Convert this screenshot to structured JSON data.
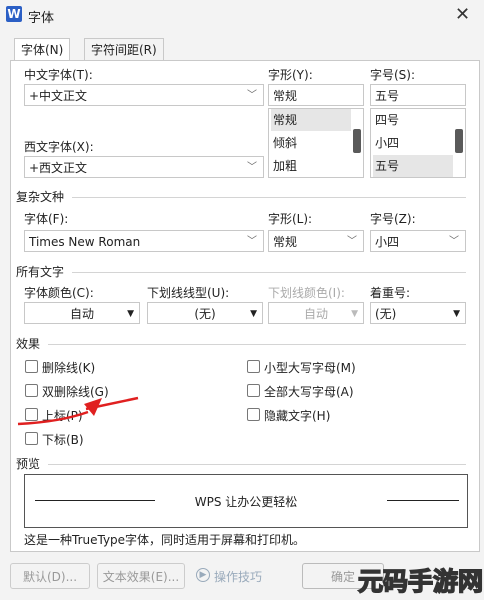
{
  "window": {
    "title": "字体",
    "logo": "W"
  },
  "tabs": [
    {
      "label": "字体(N)"
    },
    {
      "label": "字符间距(R)"
    }
  ],
  "chinese_font": {
    "label": "中文字体(T):",
    "value": "+中文正文"
  },
  "western_font": {
    "label": "西文字体(X):",
    "value": "+西文正文"
  },
  "font_style": {
    "label": "字形(Y):",
    "value": "常规",
    "options": [
      "常规",
      "倾斜",
      "加粗"
    ],
    "selected": "常规"
  },
  "font_size": {
    "label": "字号(S):",
    "value": "五号",
    "options": [
      "四号",
      "小四",
      "五号"
    ],
    "selected": "五号"
  },
  "complex": {
    "section": "复杂文种",
    "font_label": "字体(F):",
    "font_value": "Times New Roman",
    "style_label": "字形(L):",
    "style_value": "常规",
    "size_label": "字号(Z):",
    "size_value": "小四"
  },
  "all_text": {
    "section": "所有文字",
    "color_label": "字体颜色(C):",
    "color_value": "自动",
    "underline_label": "下划线线型(U):",
    "underline_value": "(无)",
    "underline_color_label": "下划线颜色(I):",
    "underline_color_value": "自动",
    "emphasis_label": "着重号:",
    "emphasis_value": "(无)"
  },
  "effects": {
    "section": "效果",
    "left": [
      "删除线(K)",
      "双删除线(G)",
      "上标(P)",
      "下标(B)"
    ],
    "right": [
      "小型大写字母(M)",
      "全部大写字母(A)",
      "隐藏文字(H)"
    ]
  },
  "preview": {
    "section": "预览",
    "text": "WPS 让办公更轻松"
  },
  "note": "这是一种TrueType字体，同时适用于屏幕和打印机。",
  "buttons": {
    "default": "默认(D)...",
    "text_effects": "文本效果(E)...",
    "tips": "操作技巧",
    "ok": "确定"
  },
  "watermark": "元码手游网",
  "colors": {
    "arrow": "#e02020",
    "logo": "#2b5fc5"
  }
}
